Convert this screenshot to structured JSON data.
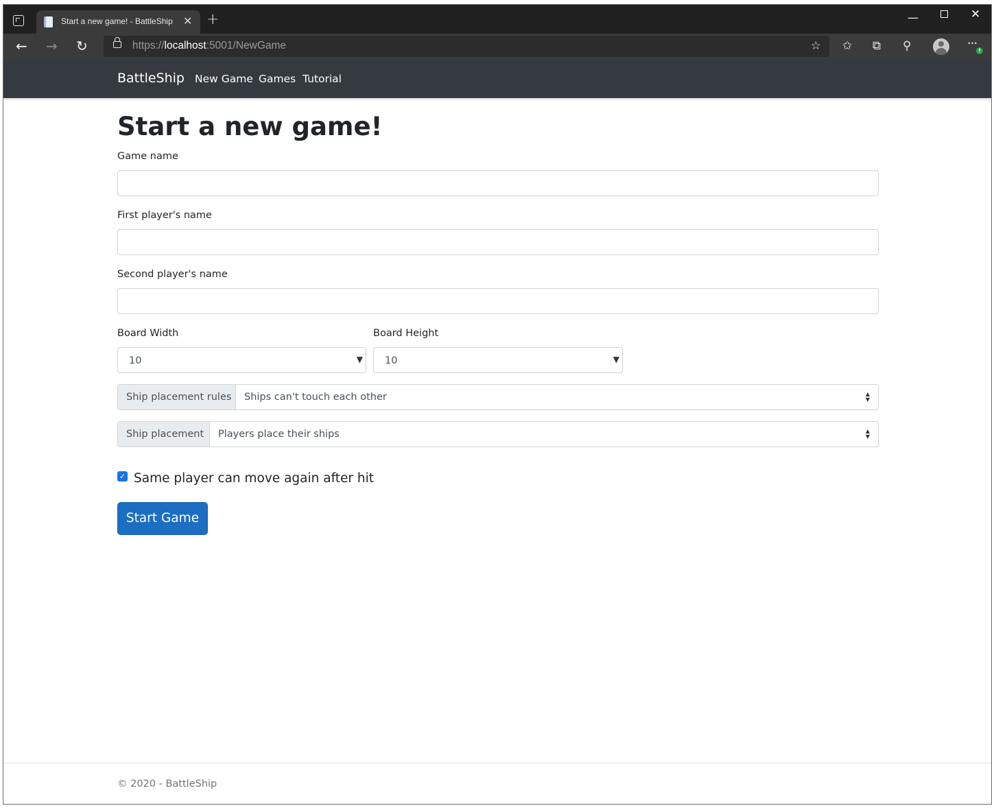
{
  "browser": {
    "tab_title": "Start a new game! - BattleShip",
    "new_tab": "+",
    "url_scheme": "https://",
    "url_host": "localhost",
    "url_rest": ":5001/NewGame"
  },
  "navbar": {
    "brand": "BattleShip",
    "links": [
      "New Game",
      "Games",
      "Tutorial"
    ]
  },
  "page": {
    "title": "Start a new game!",
    "game_name_label": "Game name",
    "game_name_value": "",
    "player1_label": "First player's name",
    "player1_value": "",
    "player2_label": "Second player's name",
    "player2_value": "",
    "board_width_label": "Board Width",
    "board_width_value": "10",
    "board_height_label": "Board Height",
    "board_height_value": "10",
    "placement_rules_label": "Ship placement rules",
    "placement_rules_value": "Ships can't touch each other",
    "placement_label": "Ship placement",
    "placement_value": "Players place their ships",
    "same_player_label": "Same player can move again after hit",
    "same_player_checked": true,
    "start_button": "Start Game"
  },
  "footer": {
    "text": "© 2020 - BattleShip"
  },
  "colors": {
    "navbar_bg": "#343a40",
    "primary": "#1b6ec2",
    "addon_bg": "#e9ecef"
  }
}
